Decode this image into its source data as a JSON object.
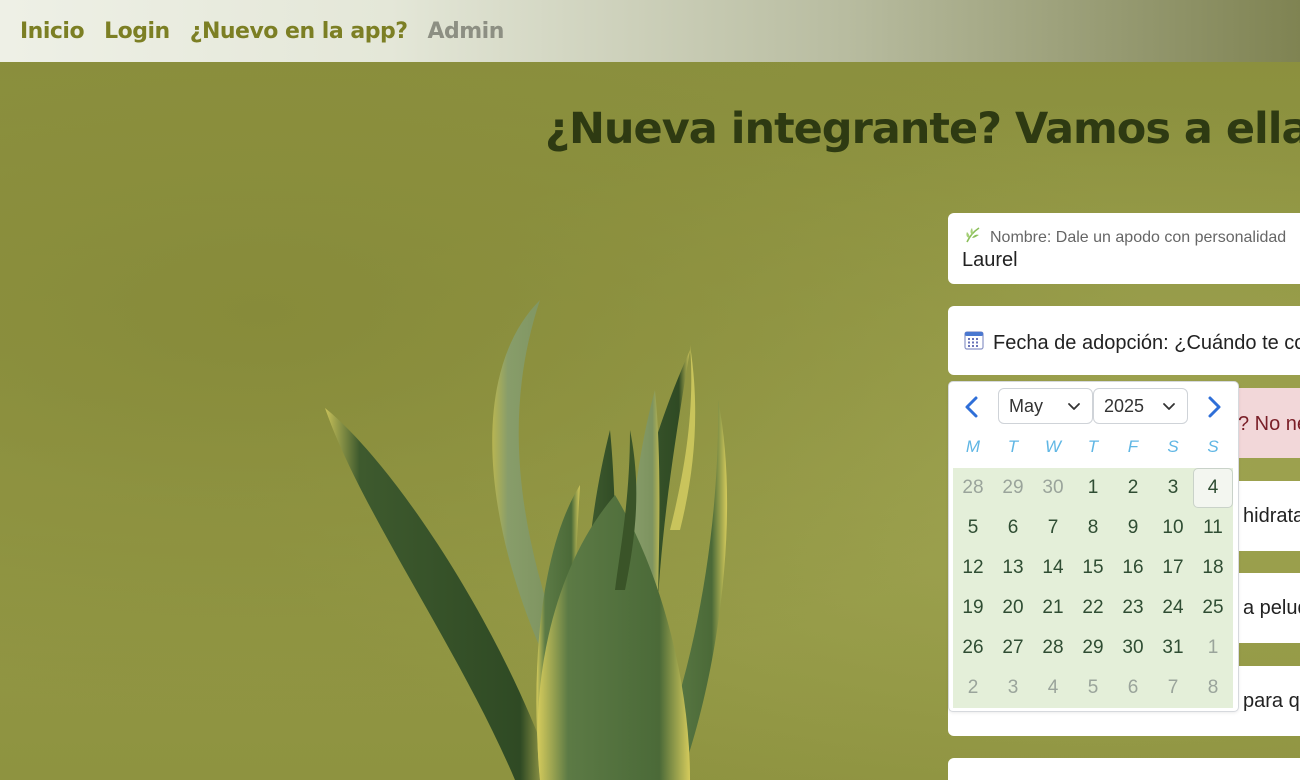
{
  "nav": {
    "items": [
      {
        "label": "Inicio"
      },
      {
        "label": "Login"
      },
      {
        "label": "¿Nuevo en la app?"
      },
      {
        "label": "Admin"
      }
    ]
  },
  "page": {
    "title": "¿Nueva integrante? Vamos a ella"
  },
  "form": {
    "name_label": "Nombre: Dale un apodo con personalidad",
    "name_value": "Laurel",
    "date_label": "Fecha de adopción: ¿Cuándo te co",
    "alert_text": "? No ne",
    "field3_text": "hidrata",
    "field4_text": "a peluq",
    "field5_text": "para que"
  },
  "datepicker": {
    "month": "May",
    "year": "2025",
    "weekdays": [
      "M",
      "T",
      "W",
      "T",
      "F",
      "S",
      "S"
    ],
    "weeks": [
      [
        "28",
        "29",
        "30",
        "1",
        "2",
        "3",
        "4"
      ],
      [
        "5",
        "6",
        "7",
        "8",
        "9",
        "10",
        "11"
      ],
      [
        "12",
        "13",
        "14",
        "15",
        "16",
        "17",
        "18"
      ],
      [
        "19",
        "20",
        "21",
        "22",
        "23",
        "24",
        "25"
      ],
      [
        "26",
        "27",
        "28",
        "29",
        "30",
        "31",
        "1"
      ],
      [
        "2",
        "3",
        "4",
        "5",
        "6",
        "7",
        "8"
      ]
    ]
  },
  "colors": {
    "nav_link": "#7c7f24",
    "nav_disabled": "#8d8f83",
    "title": "#2e3a12",
    "calendar_bg": "#e4efd9",
    "weekday": "#5fb6e4",
    "arrow": "#2f6fd8",
    "alert_bg": "#f2d7d9"
  },
  "icons": {
    "name": "leaf-icon",
    "date": "calendar-icon",
    "prev": "chevron-left-icon",
    "next": "chevron-right-icon",
    "dropdown": "chevron-down-icon"
  }
}
